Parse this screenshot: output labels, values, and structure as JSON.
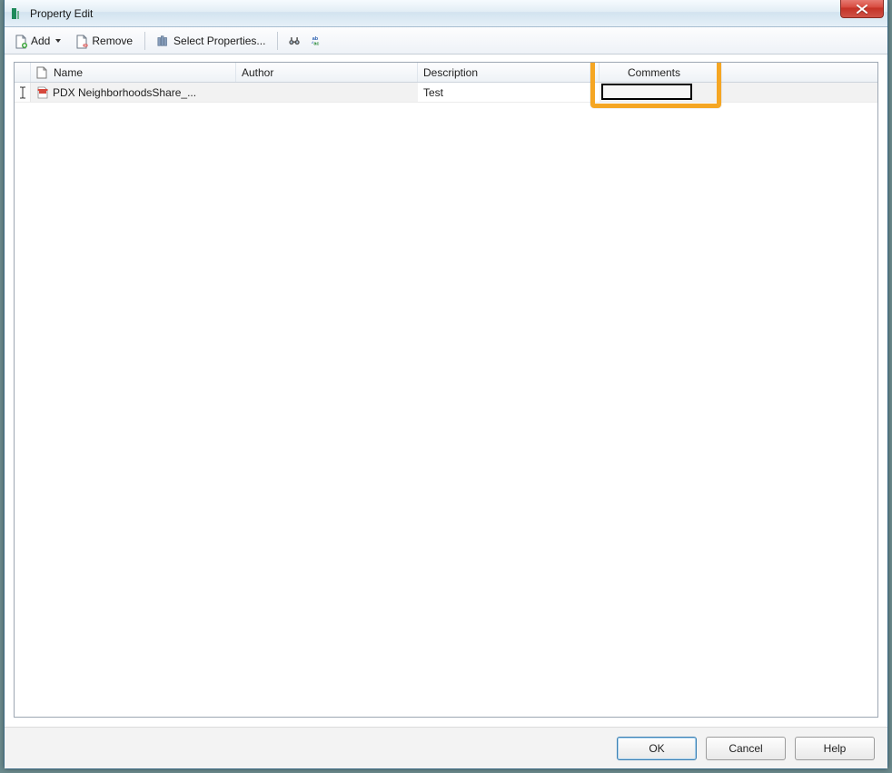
{
  "window": {
    "title": "Property Edit"
  },
  "toolbar": {
    "add_label": "Add",
    "remove_label": "Remove",
    "select_properties_label": "Select Properties..."
  },
  "grid": {
    "columns": {
      "name": "Name",
      "author": "Author",
      "description": "Description",
      "comments": "Comments"
    },
    "rows": [
      {
        "name": "PDX NeighborhoodsShare_...",
        "author": "",
        "description": "Test",
        "comments": ""
      }
    ]
  },
  "footer": {
    "ok": "OK",
    "cancel": "Cancel",
    "help": "Help"
  }
}
